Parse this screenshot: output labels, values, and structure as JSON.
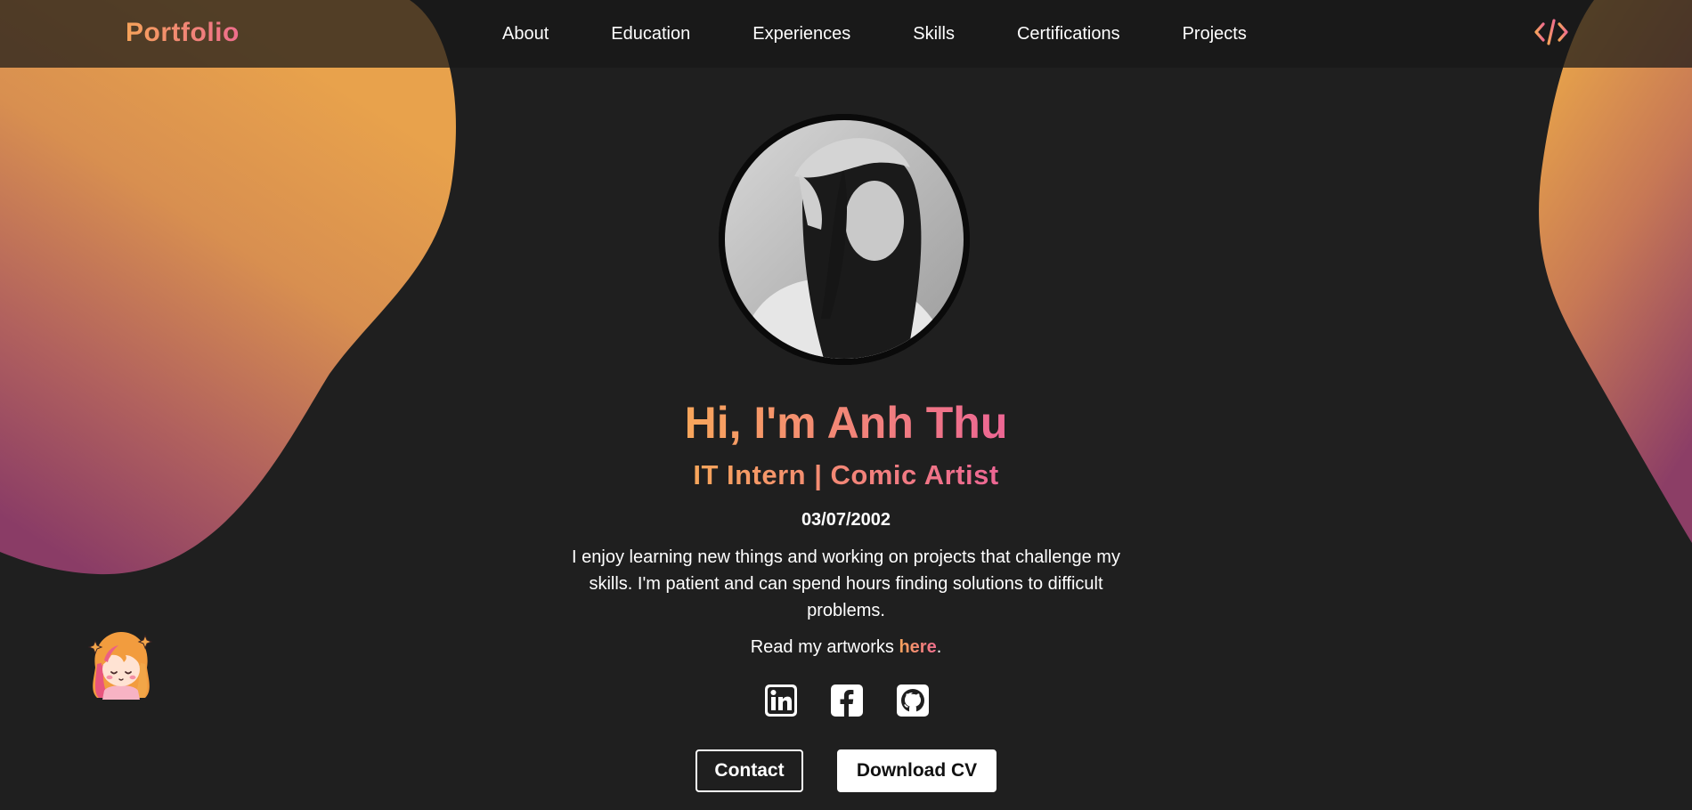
{
  "brand": "Portfolio",
  "nav": {
    "items": [
      {
        "label": "About"
      },
      {
        "label": "Education"
      },
      {
        "label": "Experiences"
      },
      {
        "label": "Skills"
      },
      {
        "label": "Certifications"
      },
      {
        "label": "Projects"
      }
    ],
    "code_icon": "code-brackets-icon"
  },
  "hero": {
    "avatar_alt": "profile-photo",
    "headline": "Hi, I'm Anh Thu",
    "subtitle": "IT Intern | Comic Artist",
    "dob": "03/07/2002",
    "bio": "I enjoy learning new things and working on projects that challenge my skills. I'm patient and can spend hours finding solutions to difficult problems.",
    "read_prefix": "Read my artworks ",
    "read_link": "here",
    "read_suffix": ".",
    "socials": [
      {
        "icon": "linkedin-icon"
      },
      {
        "icon": "facebook-icon"
      },
      {
        "icon": "github-icon"
      }
    ],
    "buttons": {
      "contact": "Contact",
      "download": "Download CV"
    }
  },
  "colors": {
    "background": "#1f1f1f",
    "gradient_start": "#f6a35a",
    "gradient_end": "#ee6d8d",
    "navbar": "#181818"
  }
}
